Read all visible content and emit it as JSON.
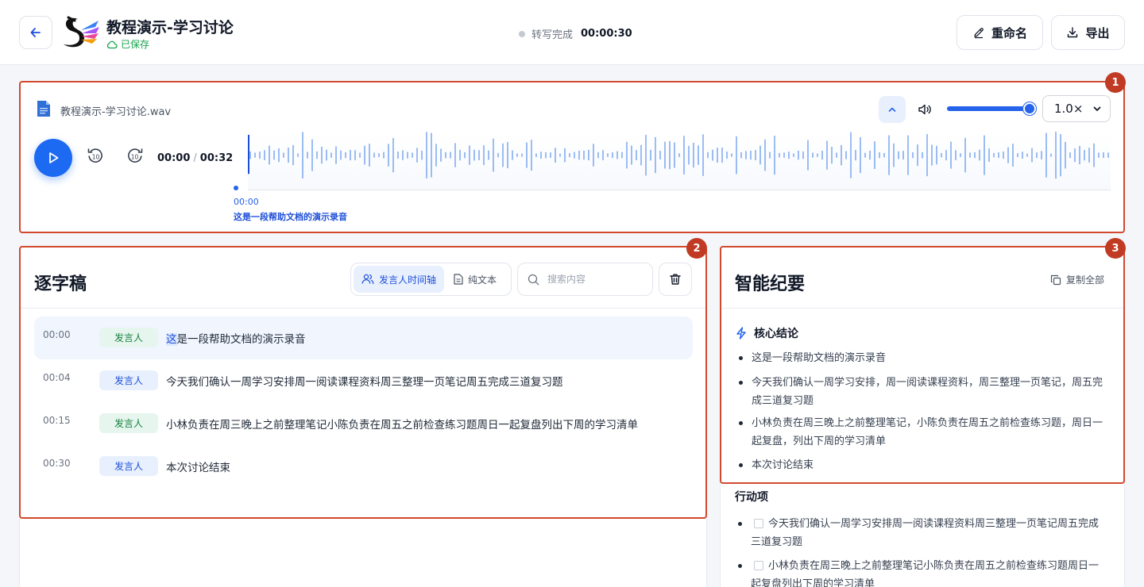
{
  "header": {
    "title": "教程演示-学习讨论",
    "saved_label": "已保存",
    "status_label": "转写完成",
    "status_time": "00:00:30",
    "rename_label": "重命名",
    "export_label": "导出"
  },
  "player": {
    "file_name": "教程演示-学习讨论.wav",
    "speed": "1.0×",
    "speed_options": [
      "1.0×"
    ],
    "current_time": "00:00",
    "separator": "/",
    "duration": "00:32",
    "volume": 1.0,
    "marker_time": "00:00",
    "marker_text": "这是一段帮助文档的演示录音"
  },
  "transcript": {
    "title": "逐字稿",
    "badge": "2",
    "toggle_speaker": "发言人时间轴",
    "toggle_plain": "纯文本",
    "search_placeholder": "搜索内容",
    "rows": [
      {
        "time": "00:00",
        "speaker": "发言人",
        "hl": "这",
        "text": "是一段帮助文档的演示录音"
      },
      {
        "time": "00:04",
        "speaker": "发言人",
        "hl": "",
        "text": "今天我们确认一周学习安排周一阅读课程资料周三整理一页笔记周五完成三道复习题"
      },
      {
        "time": "00:15",
        "speaker": "发言人",
        "hl": "",
        "text": "小林负责在周三晚上之前整理笔记小陈负责在周五之前检查练习题周日一起复盘列出下周的学习清单"
      },
      {
        "time": "00:30",
        "speaker": "发言人",
        "hl": "",
        "text": "本次讨论结束"
      }
    ]
  },
  "summary": {
    "title": "智能纪要",
    "badge": "3",
    "copy_all": "复制全部",
    "section_title": "核心结论",
    "bullets": [
      "这是一段帮助文档的演示录音",
      "今天我们确认一周学习安排，周一阅读课程资料，周三整理一页笔记，周五完成三道复习题",
      "小林负责在周三晚上之前整理笔记，小陈负责在周五之前检查练习题，周日一起复盘，列出下周的学习清单",
      "本次讨论结束"
    ],
    "actions_title": "行动项",
    "actions": [
      "今天我们确认一周学习安排周一阅读课程资料周三整理一页笔记周五完成三道复习题",
      "小林负责在周三晚上之前整理笔记小陈负责在周五之前检查练习题周日一起复盘列出下周的学习清单"
    ]
  },
  "badges": {
    "player": "1"
  },
  "colors": {
    "accent": "#1d6af2",
    "highlight_border": "#d2492f",
    "badge": "#c13a24",
    "saved": "#16a34a"
  }
}
